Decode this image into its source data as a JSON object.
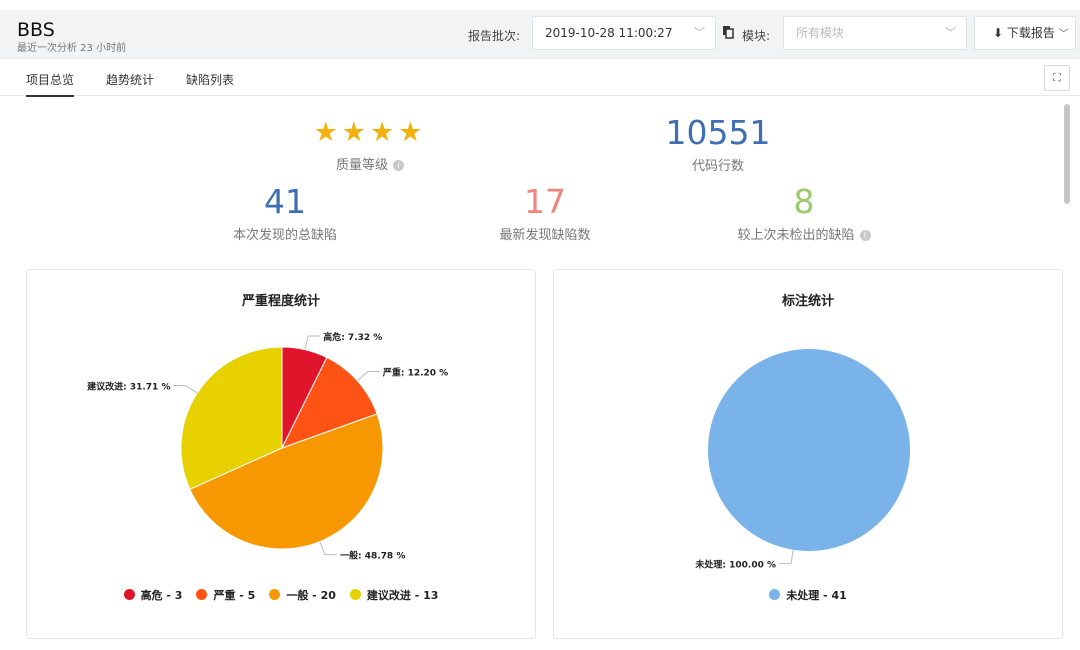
{
  "header": {
    "title": "BBS",
    "subtitle": "最近一次分析 23 小时前",
    "batch_label": "报告批次:",
    "batch_value": "2019-10-28 11:00:27",
    "module_label": "模块:",
    "module_placeholder": "所有模块",
    "download_label": "下载报告"
  },
  "tabs": [
    "项目总览",
    "趋势统计",
    "缺陷列表"
  ],
  "overview": {
    "stars": "★★★★",
    "quality_label": "质量等级",
    "lines_value": "10551",
    "lines_label": "代码行数",
    "total_value": "41",
    "total_label": "本次发现的总缺陷",
    "new_value": "17",
    "new_label": "最新发现缺陷数",
    "missed_value": "8",
    "missed_label": "较上次未检出的缺陷"
  },
  "colors": {
    "blue": "#3d6fb2",
    "salmon": "#f0857f",
    "green": "#9bca6f",
    "star": "#f3b10e"
  },
  "chart_data": [
    {
      "type": "pie",
      "title": "严重程度统计",
      "series": [
        {
          "name": "高危",
          "value": 3,
          "percent_label": "高危: 7.32 %",
          "legend": "高危 - 3",
          "color": "#e0152b"
        },
        {
          "name": "严重",
          "value": 5,
          "percent_label": "严重: 12.20 %",
          "legend": "严重 - 5",
          "color": "#ff5215"
        },
        {
          "name": "一般",
          "value": 20,
          "percent_label": "一般: 48.78 %",
          "legend": "一般 - 20",
          "color": "#f89800"
        },
        {
          "name": "建议改进",
          "value": 13,
          "percent_label": "建议改进: 31.71 %",
          "legend": "建议改进 - 13",
          "color": "#e7d100"
        }
      ]
    },
    {
      "type": "pie",
      "title": "标注统计",
      "series": [
        {
          "name": "未处理",
          "value": 41,
          "percent_label": "未处理: 100.00 %",
          "legend": "未处理 - 41",
          "color": "#79b3e9"
        }
      ]
    }
  ]
}
